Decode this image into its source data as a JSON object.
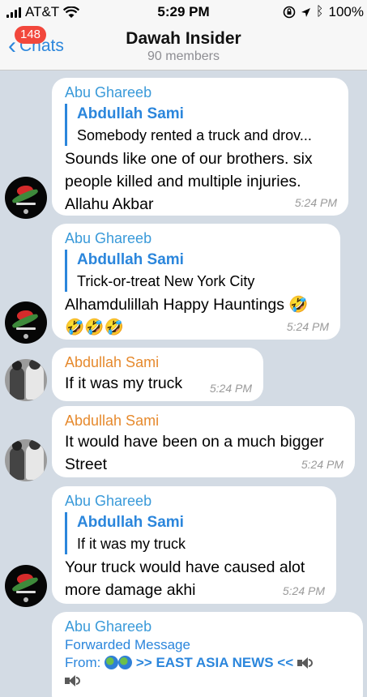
{
  "status_bar": {
    "carrier": "AT&T",
    "time": "5:29 PM",
    "battery": "100%"
  },
  "nav": {
    "back_label": "Chats",
    "badge_count": "148",
    "title": "Dawah Insider",
    "subtitle": "90 members"
  },
  "messages": [
    {
      "sender": "Abu Ghareeb",
      "quote_sender": "Abdullah Sami",
      "quote_text": "Somebody rented a truck and drov...",
      "lines": [
        "Sounds like one of our brothers. six",
        "people killed and multiple injuries.",
        "Allahu Akbar"
      ],
      "time": "5:24 PM"
    },
    {
      "sender": "Abu Ghareeb",
      "quote_sender": "Abdullah Sami",
      "quote_text": "Trick-or-treat New York City",
      "lines": [
        "Alhamdulillah Happy Hauntings 🤣",
        "🤣🤣🤣"
      ],
      "time": "5:24 PM"
    },
    {
      "sender": "Abdullah Sami",
      "lines": [
        "If it was my truck"
      ],
      "time": "5:24 PM"
    },
    {
      "sender": "Abdullah Sami",
      "lines": [
        "It would have been on a much bigger",
        "Street"
      ],
      "time": "5:24 PM"
    },
    {
      "sender": "Abu Ghareeb",
      "quote_sender": "Abdullah Sami",
      "quote_text": "If it was my truck",
      "lines": [
        "Your truck would have caused alot",
        "more damage akhi"
      ],
      "time": "5:24 PM"
    },
    {
      "sender": "Abu Ghareeb",
      "forward_label": "Forwarded Message",
      "forward_prefix": "From:",
      "forward_source": ">> EAST ASIA NEWS <<"
    }
  ],
  "colors": {
    "accent": "#2b86dc",
    "name_blue": "#3a9ad9",
    "name_orange": "#e68a2e",
    "badge": "#f2473c",
    "background": "#d3dbe4"
  }
}
